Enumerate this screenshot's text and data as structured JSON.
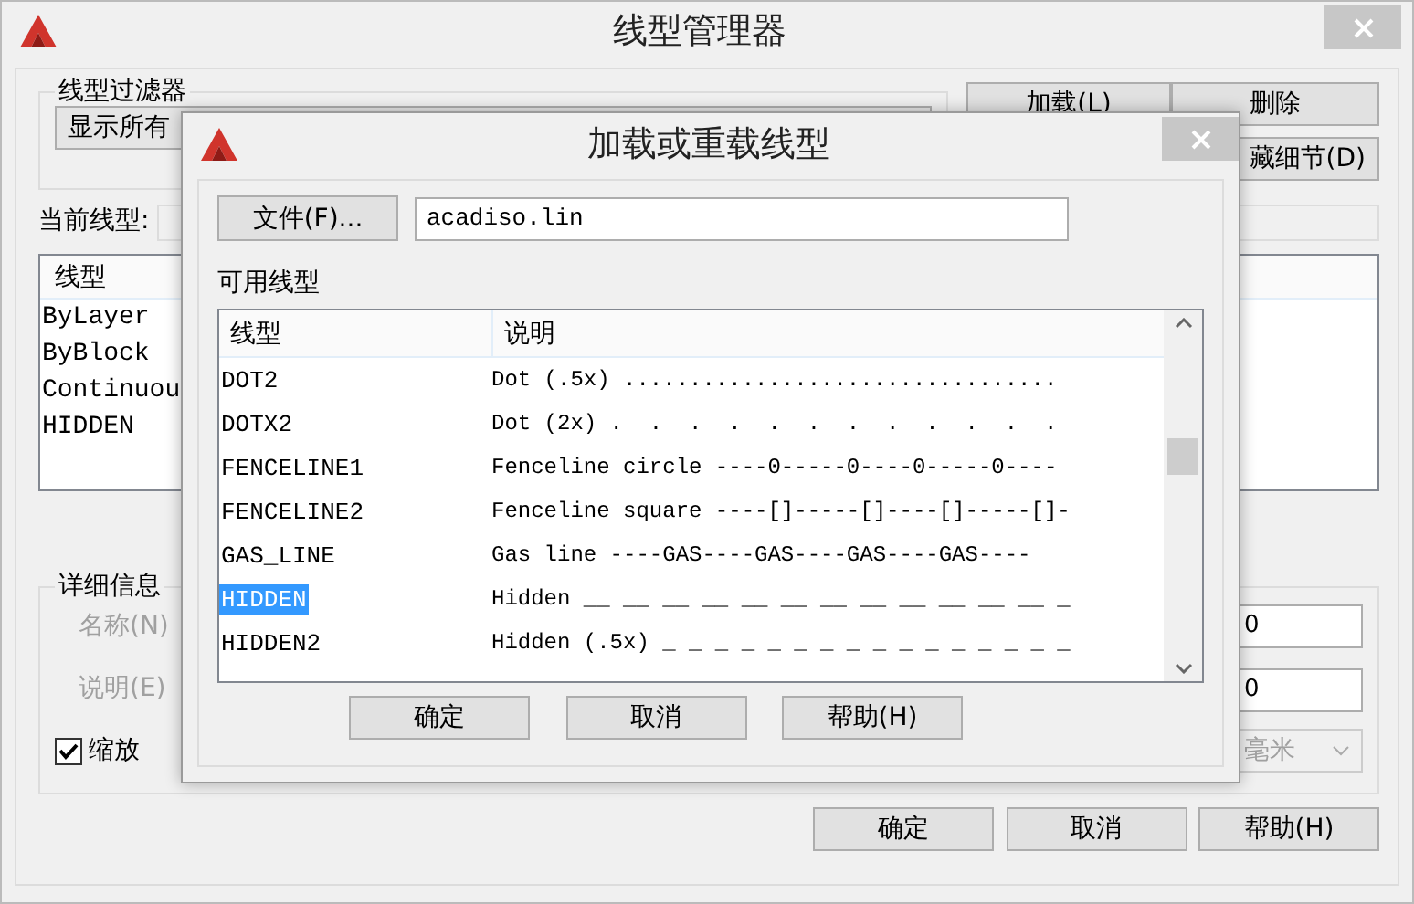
{
  "window": {
    "title": "线型管理器"
  },
  "filter": {
    "label": "线型过滤器",
    "value": "显示所有"
  },
  "top_buttons": [
    "加载(L)",
    "删除",
    "藏细节(D)"
  ],
  "current_linetype": {
    "label": "当前线型:"
  },
  "linetype_list": {
    "column": "线型",
    "rows": [
      "ByLayer",
      "ByBlock",
      "Continuou",
      "HIDDEN"
    ]
  },
  "details": {
    "label": "详细信息",
    "name_label": "名称(N)",
    "description_label": "说明(E)",
    "disabled": true,
    "field_1": "0",
    "field_2": "0",
    "scale_checkbox": {
      "label": "缩放",
      "checked": true
    },
    "units": "毫米"
  },
  "buttons": [
    "确定",
    "取消",
    "帮助(H)"
  ],
  "dialog": {
    "title": "加载或重载线型",
    "file_button": "文件(F)...",
    "file_field": {
      "value": "acadiso.lin"
    },
    "list_label": "可用线型",
    "columns": [
      "线型",
      "说明"
    ],
    "rows": [
      {
        "name": "DOT2",
        "description": "Dot (.5x) .................................",
        "selected": false
      },
      {
        "name": "DOTX2",
        "description": "Dot (2x) .  .  .  .  .  .  .  .  .  .  .  .",
        "selected": false
      },
      {
        "name": "FENCELINE1",
        "description": "Fenceline circle ----0-----0----0-----0----",
        "selected": false
      },
      {
        "name": "FENCELINE2",
        "description": "Fenceline square ----[]-----[]----[]-----[]-",
        "selected": false
      },
      {
        "name": "GAS_LINE",
        "description": "Gas line ----GAS----GAS----GAS----GAS----",
        "selected": false
      },
      {
        "name": "HIDDEN",
        "description": "Hidden __ __ __ __ __ __ __ __ __ __ __ __ _",
        "selected": true
      },
      {
        "name": "HIDDEN2",
        "description": "Hidden (.5x) _ _ _ _ _ _ _ _ _ _ _ _ _ _ _ _",
        "selected": false
      }
    ],
    "buttons": [
      "确定",
      "取消",
      "帮助(H)"
    ]
  }
}
